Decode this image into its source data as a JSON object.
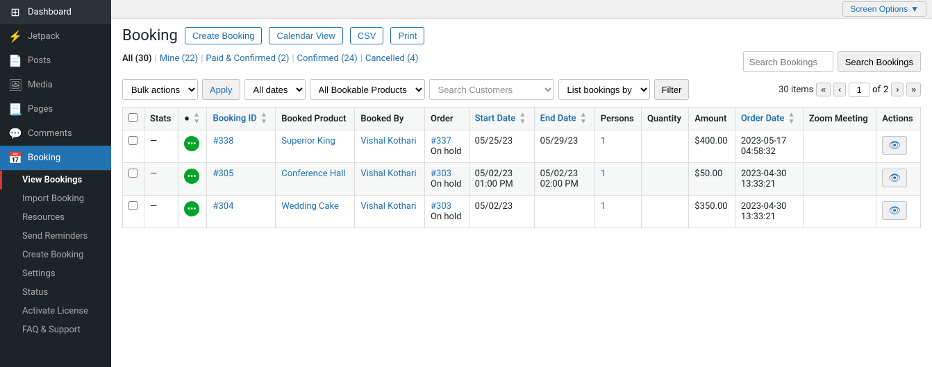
{
  "screen_options": {
    "label": "Screen Options",
    "arrow": "▼"
  },
  "sidebar": {
    "items": [
      {
        "id": "dashboard",
        "label": "Dashboard",
        "icon": "⊞"
      },
      {
        "id": "jetpack",
        "label": "Jetpack",
        "icon": "⚡"
      },
      {
        "id": "posts",
        "label": "Posts",
        "icon": "📄"
      },
      {
        "id": "media",
        "label": "Media",
        "icon": "🖼"
      },
      {
        "id": "pages",
        "label": "Pages",
        "icon": "📃"
      },
      {
        "id": "comments",
        "label": "Comments",
        "icon": "💬"
      },
      {
        "id": "booking",
        "label": "Booking",
        "icon": "📅",
        "active": true
      }
    ],
    "sub_items": [
      {
        "id": "view-bookings",
        "label": "View Bookings",
        "active": true
      },
      {
        "id": "import-booking",
        "label": "Import Booking"
      },
      {
        "id": "resources",
        "label": "Resources"
      },
      {
        "id": "send-reminders",
        "label": "Send Reminders"
      },
      {
        "id": "create-booking",
        "label": "Create Booking"
      },
      {
        "id": "settings",
        "label": "Settings"
      },
      {
        "id": "status",
        "label": "Status"
      },
      {
        "id": "activate-license",
        "label": "Activate License"
      },
      {
        "id": "faq-support",
        "label": "FAQ & Support"
      }
    ]
  },
  "page": {
    "title": "Booking",
    "buttons": [
      {
        "id": "create-booking",
        "label": "Create Booking"
      },
      {
        "id": "calendar-view",
        "label": "Calendar View"
      },
      {
        "id": "csv",
        "label": "CSV"
      },
      {
        "id": "print",
        "label": "Print"
      }
    ]
  },
  "filter_tabs": [
    {
      "id": "all",
      "label": "All",
      "count": "30",
      "active": true
    },
    {
      "id": "mine",
      "label": "Mine",
      "count": "22"
    },
    {
      "id": "paid-confirmed",
      "label": "Paid & Confirmed",
      "count": "2"
    },
    {
      "id": "confirmed",
      "label": "Confirmed",
      "count": "24"
    },
    {
      "id": "cancelled",
      "label": "Cancelled",
      "count": "4"
    }
  ],
  "toolbar": {
    "bulk_actions": "Bulk actions",
    "apply": "Apply",
    "all_dates": "All dates",
    "all_products": "All Bookable Products",
    "search_customers_placeholder": "Search Customers",
    "list_bookings_by": "List bookings by",
    "filter": "Filter",
    "items_count": "30 items",
    "page_current": "1",
    "page_total": "2",
    "search_bookings_placeholder": "Search Bookings"
  },
  "table": {
    "columns": [
      {
        "id": "stats",
        "label": "Stats"
      },
      {
        "id": "booking-id",
        "label": "Booking ID",
        "sortable": true
      },
      {
        "id": "booked-product",
        "label": "Booked Product"
      },
      {
        "id": "booked-by",
        "label": "Booked By"
      },
      {
        "id": "order",
        "label": "Order"
      },
      {
        "id": "start-date",
        "label": "Start Date",
        "sortable": true
      },
      {
        "id": "end-date",
        "label": "End Date",
        "sortable": true
      },
      {
        "id": "persons",
        "label": "Persons"
      },
      {
        "id": "quantity",
        "label": "Quantity"
      },
      {
        "id": "amount",
        "label": "Amount"
      },
      {
        "id": "order-date",
        "label": "Order Date",
        "sortable": true
      },
      {
        "id": "zoom-meeting",
        "label": "Zoom Meeting"
      },
      {
        "id": "actions",
        "label": "Actions"
      }
    ],
    "rows": [
      {
        "id": "338",
        "booking_id": "#338",
        "booked_product": "Superior King",
        "booked_by": "Vishal Kothari",
        "order": "#337",
        "order_status": "On hold",
        "start_date": "05/25/23",
        "end_date": "05/29/23",
        "persons": "1",
        "quantity": "",
        "amount": "$400.00",
        "order_date": "2023-05-17 04:58:32",
        "dash": "—",
        "status_color": "#00a32a"
      },
      {
        "id": "305",
        "booking_id": "#305",
        "booked_product": "Conference Hall",
        "booked_by": "Vishal Kothari",
        "order": "#303",
        "order_status": "On hold",
        "start_date": "05/02/23 01:00 PM",
        "end_date": "05/02/23 02:00 PM",
        "persons": "1",
        "quantity": "",
        "amount": "$50.00",
        "order_date": "2023-04-30 13:33:21",
        "dash": "—",
        "status_color": "#00a32a"
      },
      {
        "id": "304",
        "booking_id": "#304",
        "booked_product": "Wedding Cake",
        "booked_by": "Vishal Kothari",
        "order": "#303",
        "order_status": "On hold",
        "start_date": "05/02/23",
        "end_date": "",
        "persons": "1",
        "quantity": "",
        "amount": "$350.00",
        "order_date": "2023-04-30 13:33:21",
        "dash": "—",
        "status_color": "#00a32a"
      }
    ]
  }
}
